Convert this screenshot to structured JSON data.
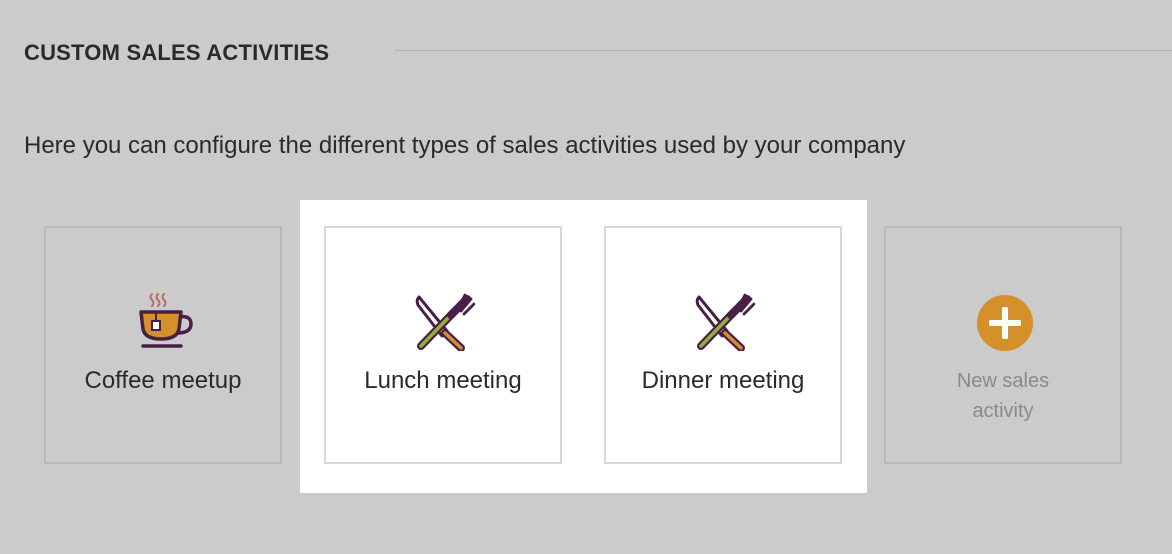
{
  "section": {
    "title": "CUSTOM SALES ACTIVITIES",
    "description": "Here you can configure the different types of sales activities used by your company"
  },
  "activities": [
    {
      "label": "Coffee meetup",
      "icon": "coffee-cup-icon",
      "selected": false
    },
    {
      "label": "Lunch meeting",
      "icon": "fork-knife-icon",
      "selected": true
    },
    {
      "label": "Dinner meeting",
      "icon": "fork-knife-icon",
      "selected": true
    }
  ],
  "new_activity": {
    "label": "New sales activity",
    "icon": "plus-circle-icon"
  },
  "colors": {
    "background": "#cbcbcb",
    "highlight": "#ffffff",
    "icon_dark": "#4a1f46",
    "icon_amber": "#d4902b",
    "icon_green": "#8fb13a",
    "add_button": "#d4902b",
    "steam": "#b96b6b"
  }
}
